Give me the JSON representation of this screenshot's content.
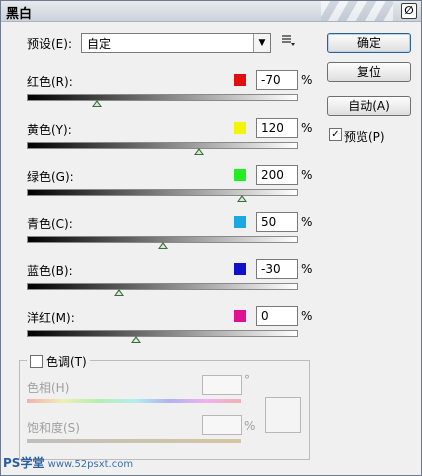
{
  "window": {
    "title": "黑白",
    "close_glyph": "∅"
  },
  "preset": {
    "label": "预设(E):",
    "value": "自定"
  },
  "buttons": {
    "ok": "确定",
    "reset": "复位",
    "auto": "自动(A)"
  },
  "preview": {
    "label": "预览(P)",
    "checked": true
  },
  "channels": [
    {
      "label": "红色(R):",
      "value": "-70",
      "pct": "%",
      "color": "#e01010"
    },
    {
      "label": "黄色(Y):",
      "value": "120",
      "pct": "%",
      "color": "#f5f500"
    },
    {
      "label": "绿色(G):",
      "value": "200",
      "pct": "%",
      "color": "#22ee22"
    },
    {
      "label": "青色(C):",
      "value": "50",
      "pct": "%",
      "color": "#1aa8e0"
    },
    {
      "label": "蓝色(B):",
      "value": "-30",
      "pct": "%",
      "color": "#1010cc"
    },
    {
      "label": "洋红(M):",
      "value": "0",
      "pct": "%",
      "color": "#e01090"
    }
  ],
  "tint": {
    "label": "色调(T)",
    "hue_label": "色相(H)",
    "hue_unit": "°",
    "saturation_label": "饱和度(S)",
    "saturation_unit": "%"
  },
  "watermark": {
    "ps": "PS学堂",
    "site": "www.52psxt.com"
  }
}
